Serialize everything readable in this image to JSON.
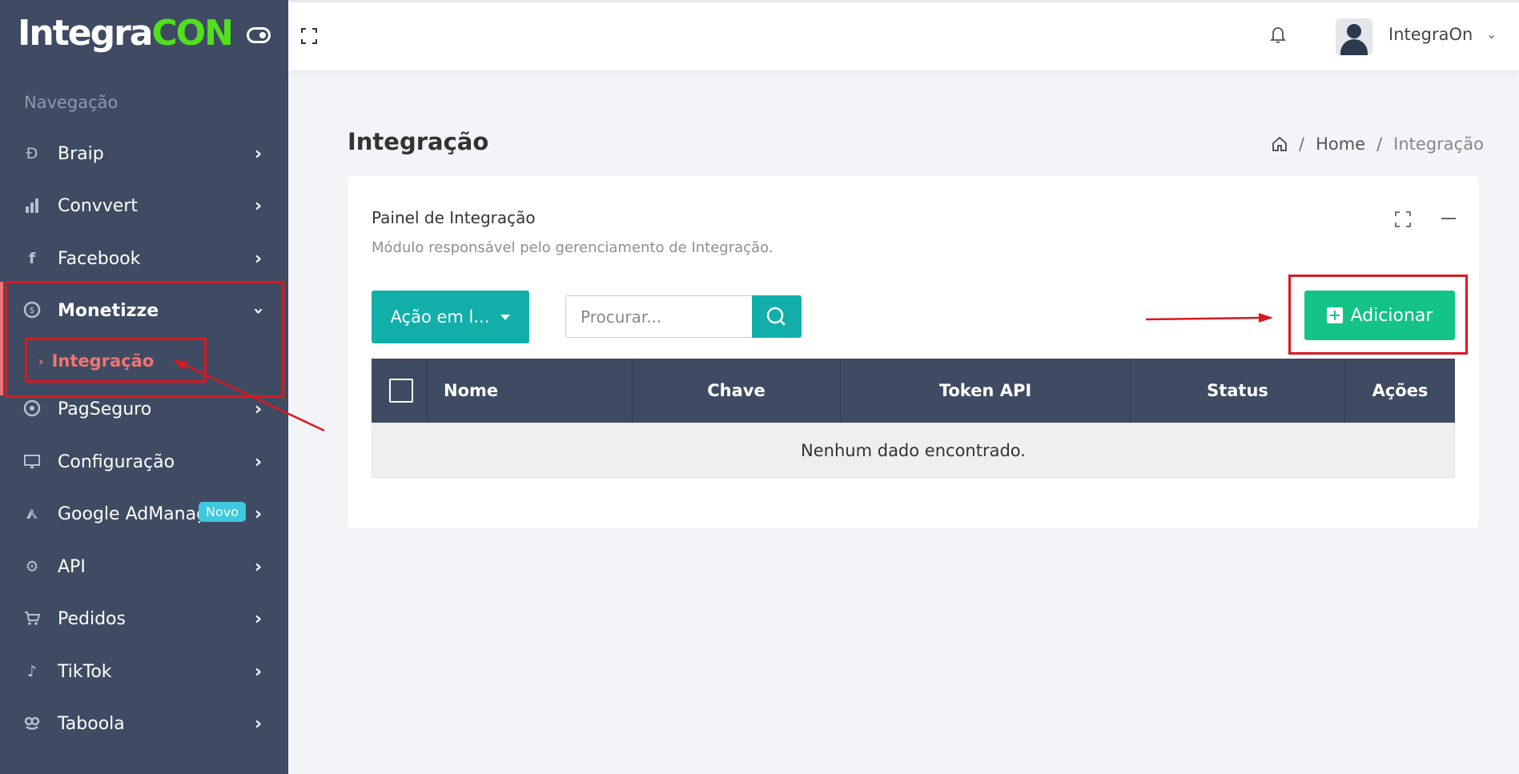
{
  "brand": {
    "logo_main": "Integra",
    "logo_c": "C",
    "logo_on": "ON"
  },
  "sidebar": {
    "section_title": "Navegação",
    "items": [
      {
        "label": "Braip",
        "icon": "braip-icon"
      },
      {
        "label": "Convvert",
        "icon": "bar-chart-icon"
      },
      {
        "label": "Facebook",
        "icon": "facebook-icon"
      },
      {
        "label": "Monetizze",
        "icon": "money-icon",
        "expanded": true
      },
      {
        "label": "PagSeguro",
        "icon": "pagseguro-icon"
      },
      {
        "label": "Configuração",
        "icon": "monitor-icon"
      },
      {
        "label": "Google AdManager",
        "icon": "google-ads-icon",
        "badge": "Novo"
      },
      {
        "label": "API",
        "icon": "api-gear-icon"
      },
      {
        "label": "Pedidos",
        "icon": "cart-icon"
      },
      {
        "label": "TikTok",
        "icon": "tiktok-icon"
      },
      {
        "label": "Taboola",
        "icon": "taboola-icon"
      }
    ],
    "sub_item": {
      "label": "Integração"
    }
  },
  "topbar": {
    "username": "IntegraOn"
  },
  "page": {
    "title": "Integração",
    "breadcrumb": {
      "home": "Home",
      "current": "Integração"
    }
  },
  "card": {
    "title": "Painel de Integração",
    "subtitle": "Módulo responsável pelo gerenciamento de Integração.",
    "bulk_action_label": "Ação em l...",
    "search_placeholder": "Procurar...",
    "add_label": "Adicionar"
  },
  "table": {
    "columns": [
      "Nome",
      "Chave",
      "Token API",
      "Status",
      "Ações"
    ],
    "empty_message": "Nenhum dado encontrado."
  },
  "colors": {
    "sidebar": "#3f4b63",
    "accent_teal": "#12aeaa",
    "add_green": "#13c388",
    "active_red": "#f27373",
    "annotation_red": "#d9191f"
  }
}
